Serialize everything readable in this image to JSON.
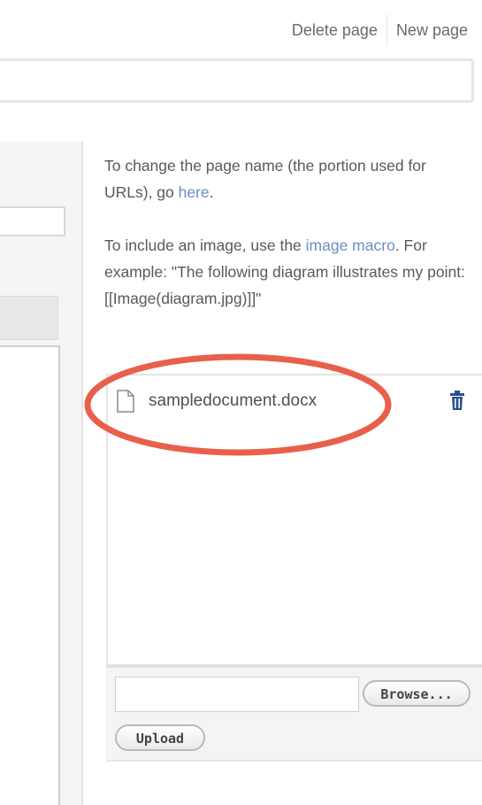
{
  "top_actions": {
    "delete_page": "Delete page",
    "new_page": "New page"
  },
  "help": {
    "rename": {
      "text_before": "To change the page name (the portion used for URLs), go ",
      "link": "here",
      "text_after": "."
    },
    "image": {
      "text_before": "To include an image, use the ",
      "link": "image macro",
      "text_after": ". For example: \"The following diagram illustrates my point: [[Image(diagram.jpg)]]\""
    }
  },
  "attachments": {
    "items": [
      {
        "filename": "sampledocument.docx",
        "icon": "document-icon"
      }
    ],
    "delete_icon": "trash-icon",
    "highlight_color": "#e8604c"
  },
  "upload": {
    "file_value": "",
    "browse_label": "Browse...",
    "upload_label": "Upload"
  },
  "colors": {
    "link": "#6b8fc2",
    "trash": "#2c4f8a"
  }
}
